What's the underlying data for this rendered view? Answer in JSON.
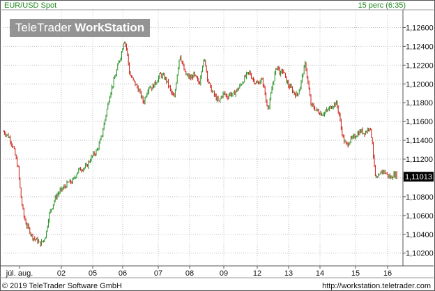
{
  "header": {
    "title": "EUR/USD Spot",
    "interval": "15 perc (6:35)"
  },
  "watermark": {
    "brand": "TeleTrader",
    "product": "WorkStation"
  },
  "footer": {
    "copyright": "© 2019 TeleTrader Software GmbH",
    "url": "http://workstation.teletrader.com"
  },
  "colors": {
    "up": "#1c8c1c",
    "down": "#c8160c",
    "grid": "#bdbdbd",
    "label": "#111111",
    "last_bg": "#000000"
  },
  "chart_data": {
    "type": "candlestick",
    "title": "EUR/USD Spot",
    "interval": "15 perc (6:35)",
    "last_value": "1,11013",
    "last": 1.11013,
    "ylim": [
      1.1005,
      1.1275
    ],
    "y_ticks": [
      "1,12600",
      "1,12400",
      "1,12200",
      "1,12000",
      "1,11800",
      "1,11600",
      "1,11400",
      "1,11200",
      "1,11000",
      "1,10800",
      "1,10600",
      "1,10400",
      "1,10200"
    ],
    "y_tick_values": [
      1.126,
      1.124,
      1.122,
      1.12,
      1.118,
      1.116,
      1.114,
      1.112,
      1.11,
      1.108,
      1.106,
      1.104,
      1.102
    ],
    "x_ticks": [
      "júl. aug.",
      "02",
      "05",
      "06",
      "07",
      "08",
      "09",
      "12",
      "13",
      "14",
      "15",
      "16"
    ],
    "grid": true,
    "path": [
      [
        0,
        1.1163
      ],
      [
        4,
        1.115
      ],
      [
        10,
        1.1146
      ],
      [
        14,
        1.1142
      ],
      [
        20,
        1.113
      ],
      [
        26,
        1.111
      ],
      [
        30,
        1.108
      ],
      [
        34,
        1.106
      ],
      [
        38,
        1.105
      ],
      [
        42,
        1.1045
      ],
      [
        46,
        1.1038
      ],
      [
        50,
        1.1035
      ],
      [
        54,
        1.1033
      ],
      [
        58,
        1.103
      ],
      [
        62,
        1.1033
      ],
      [
        66,
        1.104
      ],
      [
        70,
        1.106
      ],
      [
        74,
        1.1068
      ],
      [
        80,
        1.108
      ],
      [
        86,
        1.1086
      ],
      [
        92,
        1.109
      ],
      [
        98,
        1.1095
      ],
      [
        104,
        1.1096
      ],
      [
        108,
        1.1102
      ],
      [
        112,
        1.1108
      ],
      [
        118,
        1.111
      ],
      [
        124,
        1.1112
      ],
      [
        128,
        1.1118
      ],
      [
        134,
        1.1125
      ],
      [
        138,
        1.1128
      ],
      [
        142,
        1.1135
      ],
      [
        146,
        1.1145
      ],
      [
        150,
        1.116
      ],
      [
        154,
        1.1175
      ],
      [
        158,
        1.119
      ],
      [
        162,
        1.12
      ],
      [
        166,
        1.121
      ],
      [
        170,
        1.1222
      ],
      [
        174,
        1.1232
      ],
      [
        178,
        1.1248
      ],
      [
        182,
        1.1236
      ],
      [
        186,
        1.121
      ],
      [
        190,
        1.1205
      ],
      [
        194,
        1.12
      ],
      [
        198,
        1.1195
      ],
      [
        202,
        1.1188
      ],
      [
        206,
        1.118
      ],
      [
        210,
        1.119
      ],
      [
        214,
        1.1198
      ],
      [
        218,
        1.1196
      ],
      [
        222,
        1.12
      ],
      [
        226,
        1.1205
      ],
      [
        230,
        1.121
      ],
      [
        234,
        1.1208
      ],
      [
        238,
        1.1205
      ],
      [
        242,
        1.1198
      ],
      [
        246,
        1.119
      ],
      [
        250,
        1.1185
      ],
      [
        254,
        1.121
      ],
      [
        258,
        1.1232
      ],
      [
        262,
        1.122
      ],
      [
        266,
        1.121
      ],
      [
        270,
        1.1208
      ],
      [
        274,
        1.1206
      ],
      [
        278,
        1.121
      ],
      [
        282,
        1.1205
      ],
      [
        286,
        1.12
      ],
      [
        290,
        1.122
      ],
      [
        294,
        1.1225
      ],
      [
        298,
        1.1205
      ],
      [
        302,
        1.1195
      ],
      [
        306,
        1.119
      ],
      [
        310,
        1.1185
      ],
      [
        314,
        1.118
      ],
      [
        318,
        1.1188
      ],
      [
        322,
        1.119
      ],
      [
        326,
        1.1186
      ],
      [
        330,
        1.119
      ],
      [
        334,
        1.1188
      ],
      [
        338,
        1.1192
      ],
      [
        342,
        1.1195
      ],
      [
        346,
        1.12
      ],
      [
        350,
        1.1205
      ],
      [
        354,
        1.121
      ],
      [
        358,
        1.1212
      ],
      [
        362,
        1.1206
      ],
      [
        366,
        1.1202
      ],
      [
        370,
        1.12
      ],
      [
        374,
        1.1205
      ],
      [
        378,
        1.12
      ],
      [
        382,
        1.118
      ],
      [
        386,
        1.1175
      ],
      [
        390,
        1.1195
      ],
      [
        394,
        1.121
      ],
      [
        398,
        1.122
      ],
      [
        402,
        1.121
      ],
      [
        406,
        1.1215
      ],
      [
        410,
        1.1205
      ],
      [
        414,
        1.1198
      ],
      [
        418,
        1.1195
      ],
      [
        422,
        1.119
      ],
      [
        426,
        1.1188
      ],
      [
        430,
        1.1195
      ],
      [
        434,
        1.121
      ],
      [
        438,
        1.1222
      ],
      [
        442,
        1.12
      ],
      [
        446,
        1.1178
      ],
      [
        450,
        1.1175
      ],
      [
        454,
        1.1172
      ],
      [
        458,
        1.117
      ],
      [
        462,
        1.1168
      ],
      [
        466,
        1.117
      ],
      [
        470,
        1.1172
      ],
      [
        474,
        1.1175
      ],
      [
        478,
        1.1178
      ],
      [
        482,
        1.118
      ],
      [
        486,
        1.117
      ],
      [
        490,
        1.115
      ],
      [
        494,
        1.1138
      ],
      [
        498,
        1.1135
      ],
      [
        502,
        1.114
      ],
      [
        506,
        1.1142
      ],
      [
        510,
        1.1145
      ],
      [
        514,
        1.1148
      ],
      [
        518,
        1.115
      ],
      [
        522,
        1.1148
      ],
      [
        526,
        1.115
      ],
      [
        530,
        1.1155
      ],
      [
        534,
        1.114
      ],
      [
        536,
        1.112
      ],
      [
        538,
        1.1103
      ],
      [
        540,
        1.1098
      ],
      [
        544,
        1.1102
      ],
      [
        548,
        1.1108
      ],
      [
        552,
        1.1106
      ],
      [
        556,
        1.1103
      ],
      [
        560,
        1.11
      ],
      [
        564,
        1.1103
      ],
      [
        568,
        1.1104
      ],
      [
        570,
        1.1101
      ]
    ]
  }
}
